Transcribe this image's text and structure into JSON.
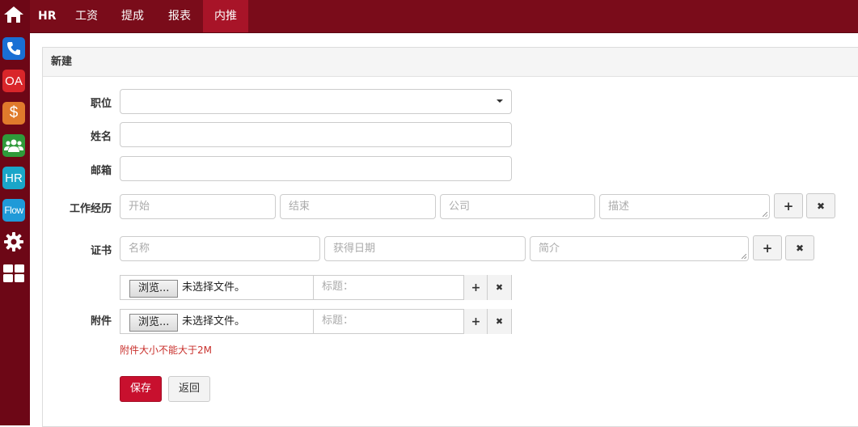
{
  "dock": {
    "items": [
      {
        "icon": "home-icon"
      },
      {
        "icon": "phone-icon"
      },
      {
        "icon": "oa-icon",
        "label": "OA"
      },
      {
        "icon": "dollar-icon",
        "label": "$"
      },
      {
        "icon": "people-icon"
      },
      {
        "icon": "hr-icon",
        "label": "HR"
      },
      {
        "icon": "flow-icon",
        "label": "Flow"
      },
      {
        "icon": "gear-icon"
      },
      {
        "icon": "grid-icon"
      }
    ]
  },
  "topnav": {
    "brand": "HR",
    "items": [
      "工资",
      "提成",
      "报表",
      "内推"
    ],
    "active": "内推"
  },
  "panel": {
    "title": "新建"
  },
  "form": {
    "position_label": "职位",
    "position_value": "",
    "name_label": "姓名",
    "email_label": "邮箱",
    "work_label": "工作经历",
    "work_start_ph": "开始",
    "work_end_ph": "结束",
    "work_company_ph": "公司",
    "work_desc_ph": "描述",
    "cert_label": "证书",
    "cert_name_ph": "名称",
    "cert_date_ph": "获得日期",
    "cert_desc_ph": "简介",
    "attach_label": "附件",
    "browse_label": "浏览...",
    "no_file": "未选择文件。",
    "title_ph": "标题：",
    "attach_hint": "附件大小不能大于2M",
    "save": "保存",
    "back": "返回",
    "plus": "+",
    "times": "✖"
  },
  "colors": {
    "brand": "#7a0c1a",
    "dock": "#6d0716",
    "active_nav": "#a81428",
    "save_button": "#c8102e",
    "hint": "#c9302c"
  }
}
